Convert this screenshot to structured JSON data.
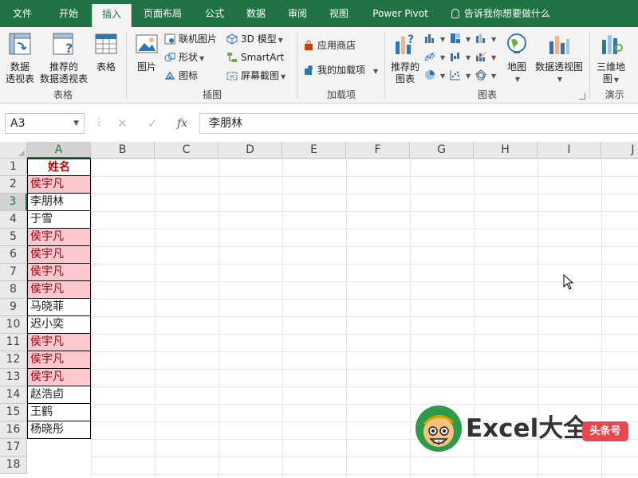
{
  "ribbon": {
    "tabs": [
      {
        "label": "文件",
        "active": false
      },
      {
        "label": "开始",
        "active": false
      },
      {
        "label": "插入",
        "active": true
      },
      {
        "label": "页面布局",
        "active": false
      },
      {
        "label": "公式",
        "active": false
      },
      {
        "label": "数据",
        "active": false
      },
      {
        "label": "审阅",
        "active": false
      },
      {
        "label": "视图",
        "active": false
      },
      {
        "label": "Power Pivot",
        "active": false
      }
    ],
    "tell_me": "告诉我你想要做什么",
    "groups": {
      "tables": {
        "label": "表格",
        "pivot_line1": "数据",
        "pivot_line2": "透视表",
        "recommended_line1": "推荐的",
        "recommended_line2": "数据透视表",
        "table": "表格"
      },
      "illustrations": {
        "label": "插图",
        "pictures": "图片",
        "online_pictures": "联机图片",
        "shapes": "形状",
        "icons": "图标",
        "models_3d": "3D 模型",
        "smartart": "SmartArt",
        "screenshot": "屏幕截图"
      },
      "addins": {
        "label": "加载项",
        "store": "应用商店",
        "my_addins": "我的加载项"
      },
      "charts": {
        "label": "图表",
        "recommended_line1": "推荐的",
        "recommended_line2": "图表",
        "maps": "地图",
        "pivot_chart": "数据透视图"
      },
      "tours": {
        "label": "演示",
        "map3d_line1": "三维地",
        "map3d_line2": "图"
      }
    }
  },
  "formula_bar": {
    "name_box": "A3",
    "fx": "fx",
    "content": "李朋林"
  },
  "sheet": {
    "columns": [
      "A",
      "B",
      "C",
      "D",
      "E",
      "F",
      "G",
      "H",
      "I",
      "J"
    ],
    "selected_column": "A",
    "selected_row": 3,
    "rows": [
      "1",
      "2",
      "3",
      "4",
      "5",
      "6",
      "7",
      "8",
      "9",
      "10",
      "11",
      "12",
      "13",
      "14",
      "15",
      "16",
      "17",
      "18"
    ],
    "column_a": [
      {
        "text": "姓名",
        "style": "header"
      },
      {
        "text": "侯宇凡",
        "style": "duplicate"
      },
      {
        "text": "李朋林",
        "style": "normal"
      },
      {
        "text": "于雪",
        "style": "normal"
      },
      {
        "text": "侯宇凡",
        "style": "duplicate"
      },
      {
        "text": "侯宇凡",
        "style": "duplicate"
      },
      {
        "text": "侯宇凡",
        "style": "duplicate"
      },
      {
        "text": "侯宇凡",
        "style": "duplicate"
      },
      {
        "text": "马晓菲",
        "style": "normal"
      },
      {
        "text": "迟小奕",
        "style": "normal"
      },
      {
        "text": "侯宇凡",
        "style": "duplicate"
      },
      {
        "text": "侯宇凡",
        "style": "duplicate"
      },
      {
        "text": "侯宇凡",
        "style": "duplicate"
      },
      {
        "text": "赵浩卣",
        "style": "normal"
      },
      {
        "text": "王鹤",
        "style": "normal"
      },
      {
        "text": "杨晓彤",
        "style": "normal"
      }
    ]
  },
  "watermark": {
    "brand": "Excel大全",
    "badge": "头条号"
  },
  "colors": {
    "ribbon_green": "#217346",
    "duplicate_fill": "#ffc7ce",
    "duplicate_text": "#9c0006",
    "header_text": "#c00000"
  }
}
